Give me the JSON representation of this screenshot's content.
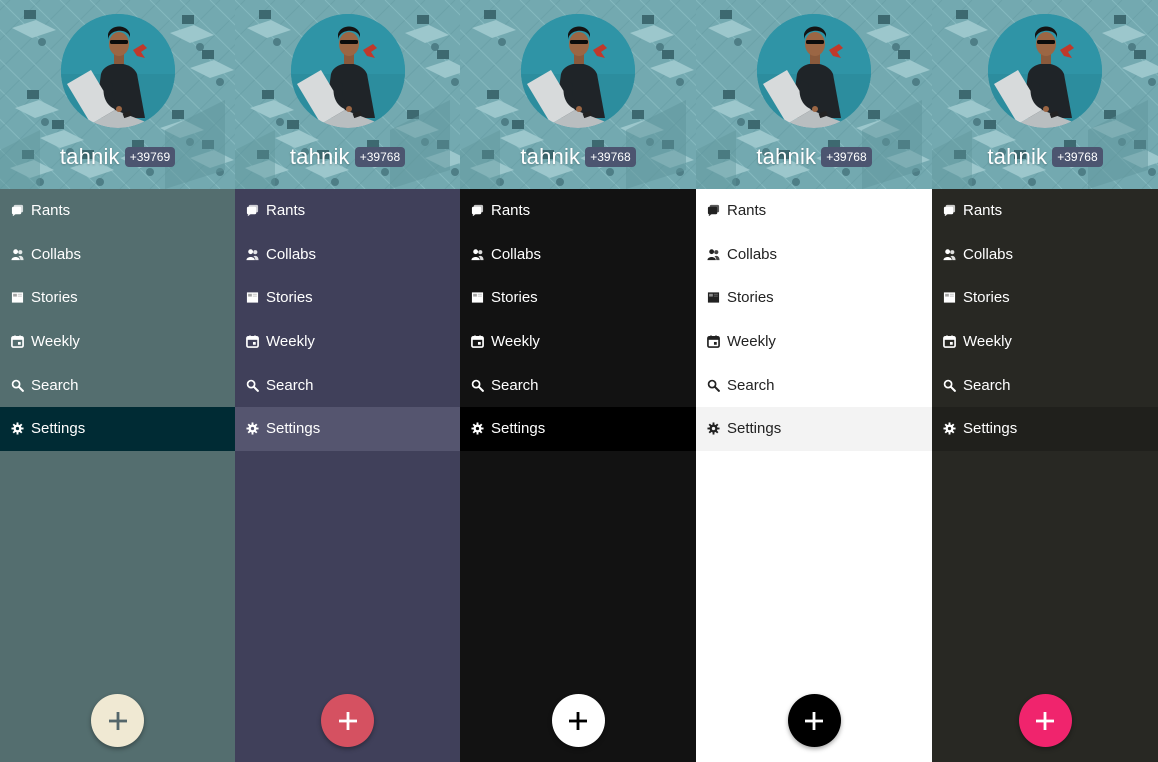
{
  "menu_labels": [
    "Rants",
    "Collabs",
    "Stories",
    "Weekly",
    "Search",
    "Settings"
  ],
  "menu_icons": [
    "rants-icon",
    "collabs-icon",
    "stories-icon",
    "weekly-icon",
    "search-icon",
    "settings-icon"
  ],
  "active_index": 5,
  "panels": [
    {
      "username": "tahnik",
      "score": "+39769",
      "bg": "#546e6f",
      "text": "#ffffff",
      "active_bg": "#002b34",
      "active_text": "#ffffff",
      "fab_bg": "#f0e9d3",
      "fab_icon": "#54666a",
      "score_bg": "#4c5570"
    },
    {
      "username": "tahnik",
      "score": "+39768",
      "bg": "#40405a",
      "text": "#ffffff",
      "active_bg": "#55556f",
      "active_text": "#ffffff",
      "fab_bg": "#d55161",
      "fab_icon": "#ffffff",
      "score_bg": "#4c5570"
    },
    {
      "username": "tahnik",
      "score": "+39768",
      "bg": "#121212",
      "text": "#ffffff",
      "active_bg": "#000000",
      "active_text": "#ffffff",
      "fab_bg": "#ffffff",
      "fab_icon": "#000000",
      "score_bg": "#4c5570"
    },
    {
      "username": "tahnik",
      "score": "+39768",
      "bg": "#ffffff",
      "text": "#222222",
      "active_bg": "#f3f3f3",
      "active_text": "#222222",
      "fab_bg": "#000000",
      "fab_icon": "#ffffff",
      "score_bg": "#4c5570"
    },
    {
      "username": "tahnik",
      "score": "+39768",
      "bg": "#282823",
      "text": "#ffffff",
      "active_bg": "#20201c",
      "active_text": "#ffffff",
      "fab_bg": "#f0246d",
      "fab_icon": "#ffffff",
      "score_bg": "#4c5570"
    }
  ]
}
